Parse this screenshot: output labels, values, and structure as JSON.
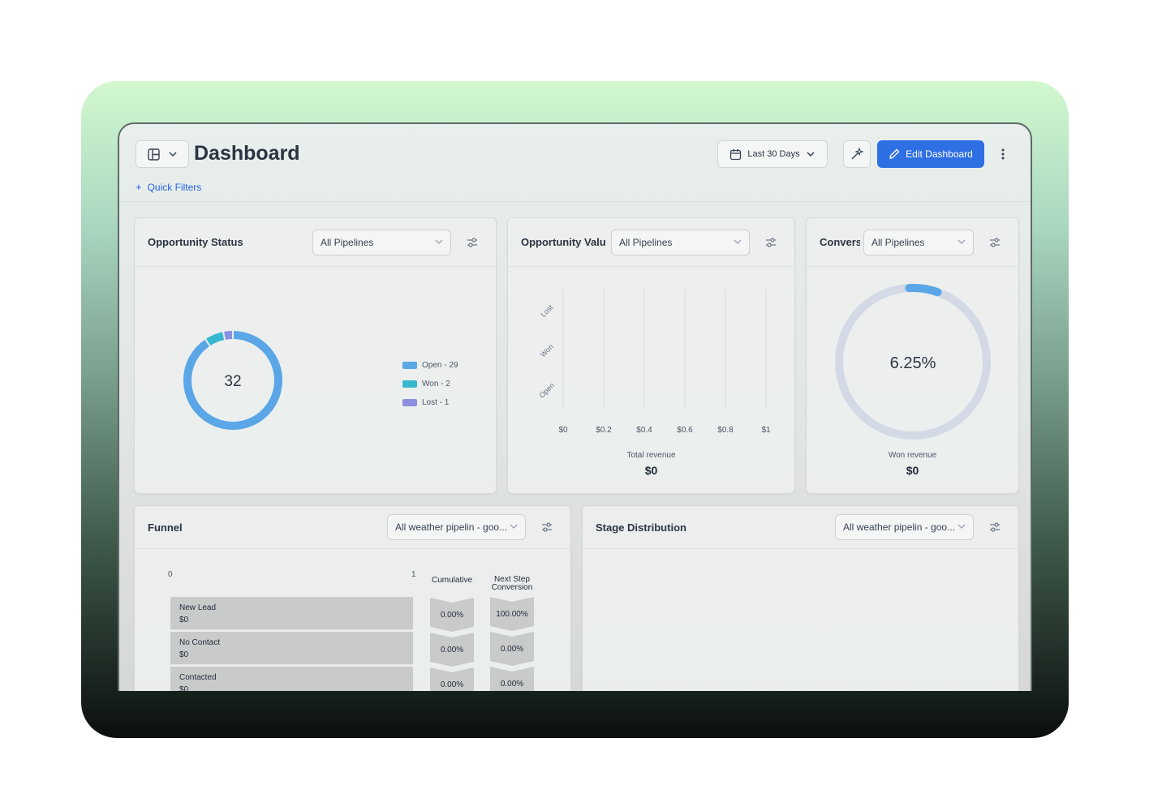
{
  "header": {
    "title": "Dashboard",
    "quick_filters": "Quick Filters",
    "date_range": "Last 30 Days",
    "edit_label": "Edit Dashboard"
  },
  "colors": {
    "accent": "#2f6fe4",
    "open": "#5aa6e6",
    "won": "#36b9d0",
    "lost": "#8b8fe0",
    "ring": "#d3dae5"
  },
  "opportunity_status": {
    "title": "Opportunity Status",
    "pipeline": "All Pipelines",
    "total": "32",
    "legend": [
      {
        "label": "Open - 29",
        "value": 29
      },
      {
        "label": "Won - 2",
        "value": 2
      },
      {
        "label": "Lost - 1",
        "value": 1
      }
    ]
  },
  "opportunity_value": {
    "title": "Opportunity Value",
    "pipeline": "All Pipelines",
    "total_label": "Total revenue",
    "total": "$0"
  },
  "conversion": {
    "title": "Conversion",
    "pipeline": "All Pipelines",
    "rate_label": "6.25%",
    "rate": 6.25,
    "won_label": "Won revenue",
    "won": "$0"
  },
  "funnel": {
    "title": "Funnel",
    "pipeline": "All weather pipelin - goo...",
    "axis_min": "0",
    "axis_max": "1",
    "col_cumulative": "Cumulative",
    "col_next_1": "Next Step",
    "col_next_2": "Conversion",
    "rows": [
      {
        "name": "New Lead",
        "value": "$0",
        "cumulative": "0.00%",
        "next": "100.00%"
      },
      {
        "name": "No Contact",
        "value": "$0",
        "cumulative": "0.00%",
        "next": "0.00%"
      },
      {
        "name": "Contacted",
        "value": "$0",
        "cumulative": "0.00%",
        "next": "0.00%"
      }
    ]
  },
  "stage_distribution": {
    "title": "Stage Distribution",
    "pipeline": "All weather pipelin - goo..."
  },
  "chart_data": {
    "type": "bar",
    "categories": [
      "Lost",
      "Won",
      "Open"
    ],
    "values": [
      0,
      0,
      0
    ],
    "x_ticks": [
      "$0",
      "$0.2",
      "$0.4",
      "$0.6",
      "$0.8",
      "$1"
    ],
    "xlim": [
      0,
      1
    ],
    "xlabel": "Total revenue",
    "grid": true
  }
}
